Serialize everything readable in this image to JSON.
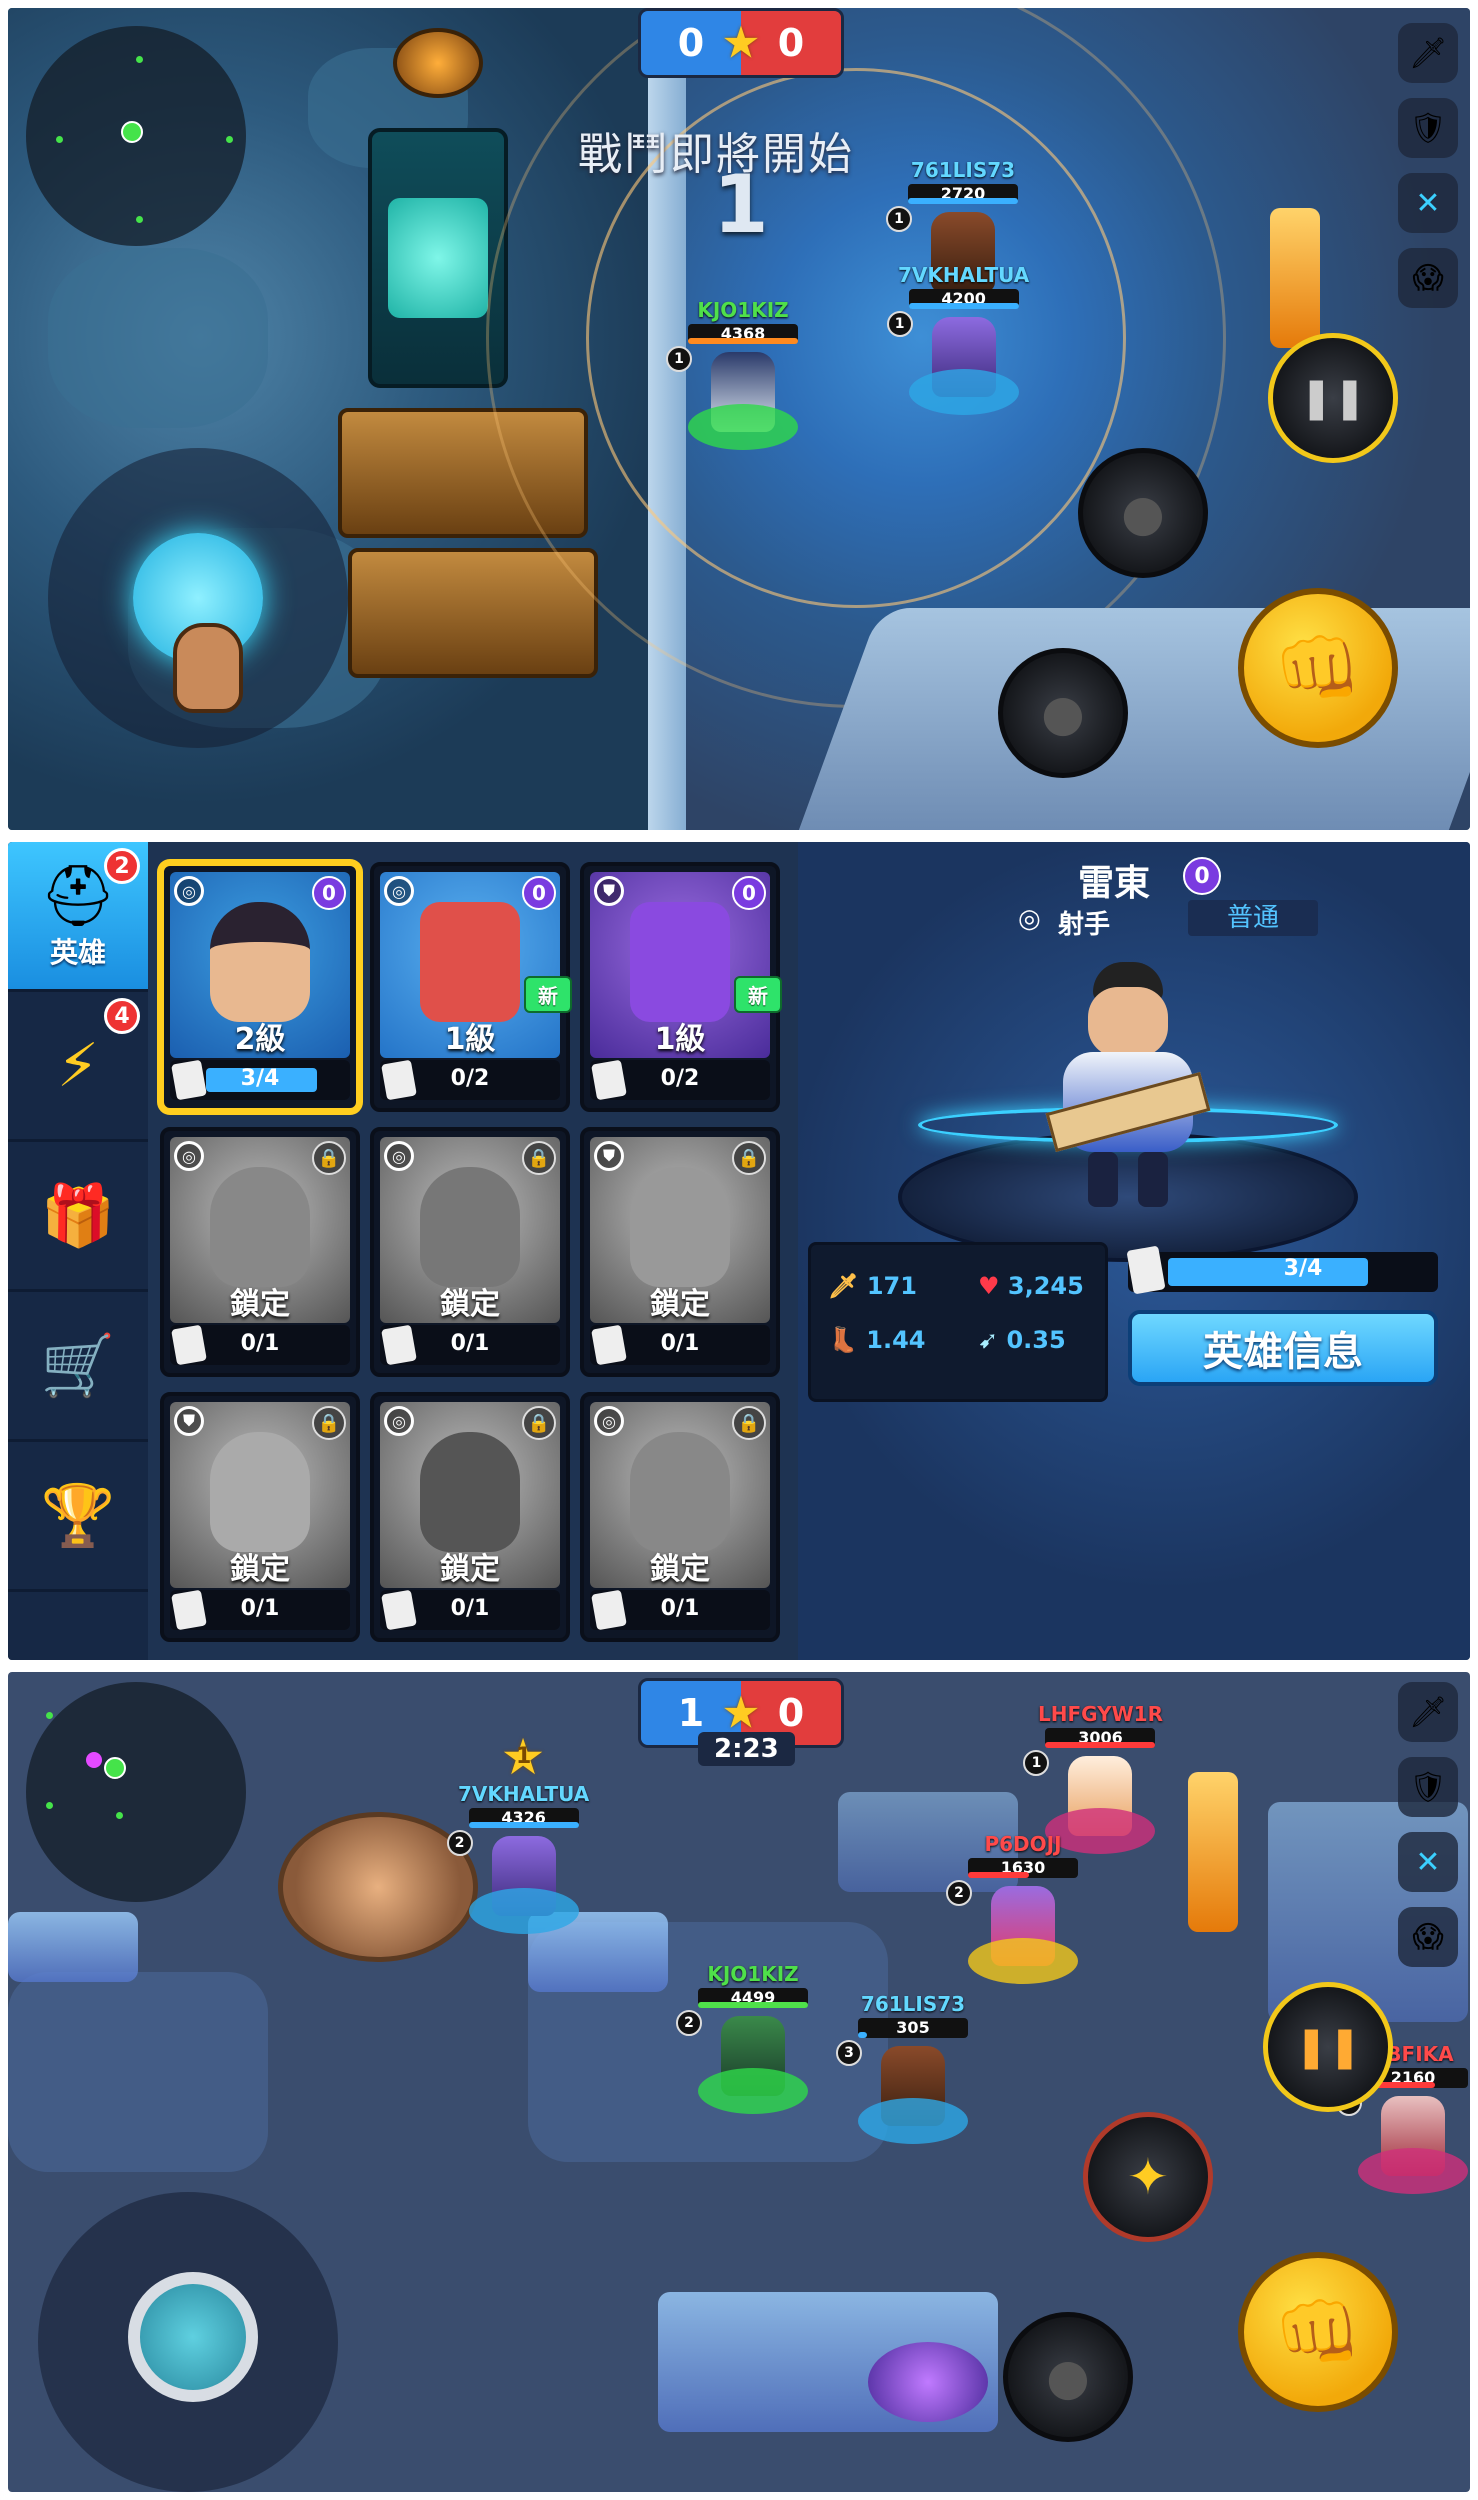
{
  "panel1": {
    "score": {
      "blue": "0",
      "red": "0"
    },
    "countdown_text": "戰鬥即將開始",
    "countdown_number": "1",
    "players": [
      {
        "name": "761LIS73",
        "level": "1",
        "hp": "2720",
        "team": "ally"
      },
      {
        "name": "7VKHALTUA",
        "level": "1",
        "hp": "4200",
        "team": "ally"
      },
      {
        "name": "KJO1KIZ",
        "level": "1",
        "hp": "4368",
        "team": "self"
      }
    ]
  },
  "panel2": {
    "tabs": [
      {
        "label": "英雄",
        "badge": "2",
        "icon": "hero-helmet-icon"
      },
      {
        "label": "",
        "badge": "4",
        "icon": "lightning-badge-icon"
      },
      {
        "label": "",
        "badge": "",
        "icon": "treasure-chest-icon"
      },
      {
        "label": "",
        "badge": "",
        "icon": "shop-cart-icon"
      },
      {
        "label": "",
        "badge": "",
        "icon": "trophy-icon"
      }
    ],
    "cards": [
      {
        "level": "2級",
        "progress": "3/4",
        "fraction": 0.75,
        "badge": "0",
        "new": "",
        "locked": false,
        "role": "target-icon"
      },
      {
        "level": "1級",
        "progress": "0/2",
        "fraction": 0,
        "badge": "0",
        "new": "新",
        "locked": false,
        "role": "target-icon"
      },
      {
        "level": "1級",
        "progress": "0/2",
        "fraction": 0,
        "badge": "0",
        "new": "新",
        "locked": false,
        "role": "shield-icon"
      },
      {
        "level": "鎖定",
        "progress": "0/1",
        "fraction": 0,
        "badge": "",
        "new": "",
        "locked": true,
        "role": "target-icon"
      },
      {
        "level": "鎖定",
        "progress": "0/1",
        "fraction": 0,
        "badge": "",
        "new": "",
        "locked": true,
        "role": "target-icon"
      },
      {
        "level": "鎖定",
        "progress": "0/1",
        "fraction": 0,
        "badge": "",
        "new": "",
        "locked": true,
        "role": "shield-icon"
      },
      {
        "level": "鎖定",
        "progress": "0/1",
        "fraction": 0,
        "badge": "",
        "new": "",
        "locked": true,
        "role": "shield-icon"
      },
      {
        "level": "鎖定",
        "progress": "0/1",
        "fraction": 0,
        "badge": "",
        "new": "",
        "locked": true,
        "role": "target-icon"
      },
      {
        "level": "鎖定",
        "progress": "0/1",
        "fraction": 0,
        "badge": "",
        "new": "",
        "locked": true,
        "role": "target-icon"
      }
    ],
    "hero": {
      "name": "雷東",
      "badge": "0",
      "role": "射手",
      "difficulty": "普通",
      "attack": "171",
      "health": "3,245",
      "speed": "1.44",
      "reload": "0.35",
      "progress": "3/4",
      "progress_fraction": 0.75,
      "info_button": "英雄信息"
    }
  },
  "panel3": {
    "score": {
      "blue": "1",
      "red": "0"
    },
    "timer": "2:23",
    "star_rank": "1",
    "players": [
      {
        "name": "LHFGYW1R",
        "level": "1",
        "hp": "3006",
        "team": "enemy"
      },
      {
        "name": "7VKHALTUA",
        "level": "2",
        "hp": "4326",
        "team": "ally"
      },
      {
        "name": "P6DOJJ",
        "level": "2",
        "hp": "1630",
        "team": "enemy"
      },
      {
        "name": "KJO1KIZ",
        "level": "2",
        "hp": "4499",
        "team": "self"
      },
      {
        "name": "761LIS73",
        "level": "3",
        "hp": "305",
        "team": "ally"
      },
      {
        "name": "8BFIKA",
        "level": "1",
        "hp": "2160",
        "team": "enemy"
      }
    ]
  },
  "colors": {
    "blue_team": "#2f86e6",
    "red_team": "#e23d3d",
    "ally_name": "#63d8ff",
    "self_name": "#4fe04a",
    "enemy_name": "#ff4a4a",
    "gold": "#ffce1f"
  }
}
